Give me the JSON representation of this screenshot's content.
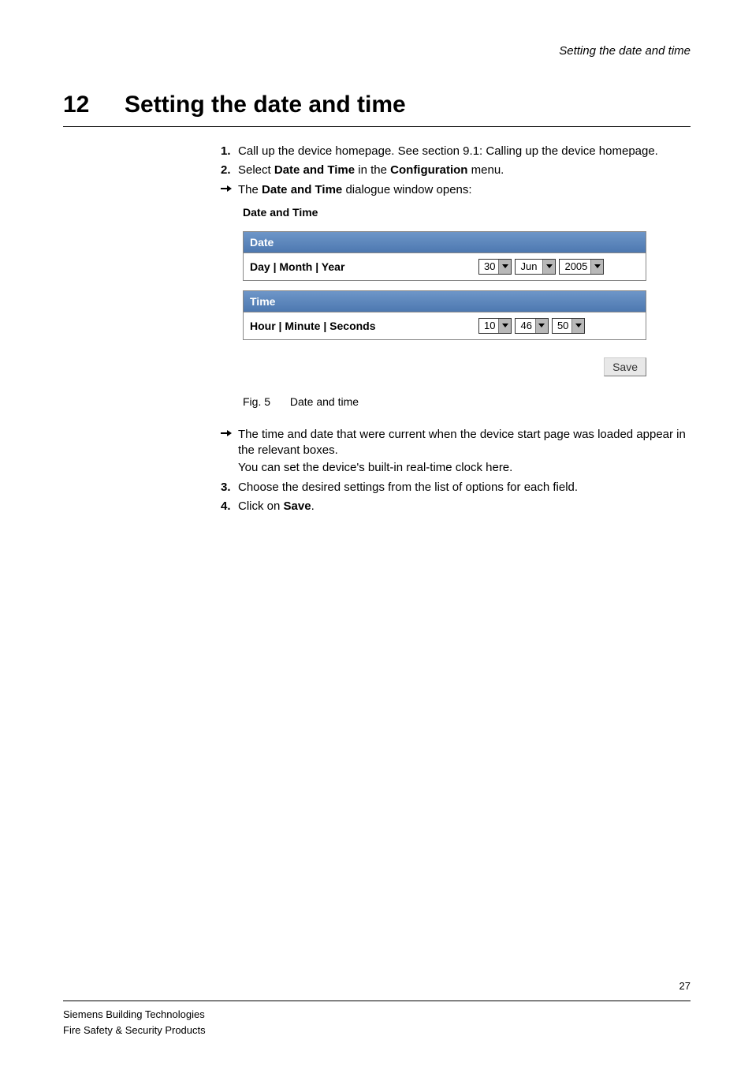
{
  "header": {
    "running_title": "Setting the date and time"
  },
  "chapter": {
    "number": "12",
    "title": "Setting the date and time"
  },
  "steps": {
    "s1": {
      "marker": "1.",
      "text_before": "Call up the device homepage. See section 9.1: Calling up the device homepage."
    },
    "s2": {
      "marker": "2.",
      "prefix": "Select ",
      "bold1": "Date and Time",
      "mid": " in the ",
      "bold2": "Configuration",
      "suffix": " menu."
    },
    "arrow1": {
      "prefix": "The ",
      "bold": "Date and Time",
      "suffix": " dialogue window opens:"
    }
  },
  "dialog": {
    "title": "Date and Time",
    "date_section": {
      "header": "Date",
      "label": "Day | Month | Year",
      "day": "30",
      "month": "Jun",
      "year": "2005"
    },
    "time_section": {
      "header": "Time",
      "label": "Hour | Minute | Seconds",
      "hour": "10",
      "minute": "46",
      "seconds": "50"
    },
    "save_label": "Save"
  },
  "figure": {
    "num": "Fig. 5",
    "caption": "Date and time"
  },
  "after": {
    "arrow2_line1": "The time and date that were current when the device start page was loaded appear in the relevant boxes.",
    "arrow2_line2": "You can set the device's built-in real-time clock here.",
    "s3": {
      "marker": "3.",
      "text": "Choose the desired settings from the list of options for each field."
    },
    "s4": {
      "marker": "4.",
      "prefix": "Click on ",
      "bold": "Save",
      "suffix": "."
    }
  },
  "page_number": "27",
  "footer": {
    "line1": "Siemens Building Technologies",
    "line2": "Fire Safety & Security Products"
  }
}
